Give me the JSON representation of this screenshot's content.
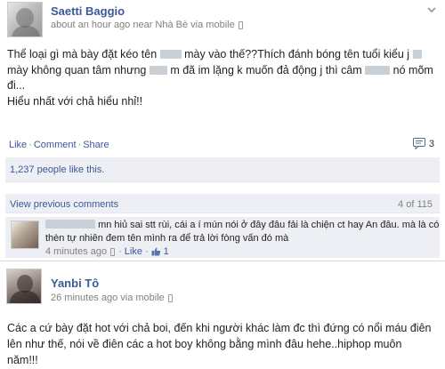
{
  "post1": {
    "author": "Saetti Baggio",
    "meta_time": "about an hour ago near Nhà Bè via mobile",
    "lines": [
      {
        "parts": [
          "Thể loại gì mà bày đặt kéo tên ",
          " mày vào thế??Thích đánh bóng tên tuổi kiểu j ",
          ""
        ]
      },
      {
        "parts": [
          "mày không quan tâm nhưng ",
          " m đã im lặng k muốn đả động j thì câm ",
          " nó mõm"
        ]
      },
      {
        "parts": [
          "đi..."
        ]
      },
      {
        "parts": [
          "Hiểu nhất với chả hiểu nhỉ!!"
        ]
      }
    ],
    "actions": {
      "like": "Like",
      "comment": "Comment",
      "share": "Share",
      "sep": "·"
    },
    "comment_count": "3",
    "likes_text": "1,237 people like this.",
    "view_previous": "View previous comments",
    "comments_position": "4 of 115",
    "comment": {
      "line1": "mn hiủ sai stt rùi, cái a í mún nói ở đây đâu fải là chiện ct hay An đâu. mà là có",
      "line2": "thèn tự nhiên đem tên mình ra để trả lời fòng vấn đó mà",
      "time": "4 minutes ago",
      "like": "Like",
      "likes": "1"
    }
  },
  "post2": {
    "author": "Yanbi Tô",
    "meta_time": "26 minutes ago via mobile",
    "lines": [
      "Các a cứ bày đặt hot với chả boi, đến khi người khác làm đc thì đứng có nổi máu điên",
      "lên như thế, nói về điên các a hot boy không bằng mình đâu hehe..hiphop muôn",
      "năm!!!"
    ]
  },
  "colors": {
    "link": "#3b5998",
    "meta": "#808080",
    "ufi_bg": "#edeff4",
    "redaction": "#c9cfd6"
  }
}
